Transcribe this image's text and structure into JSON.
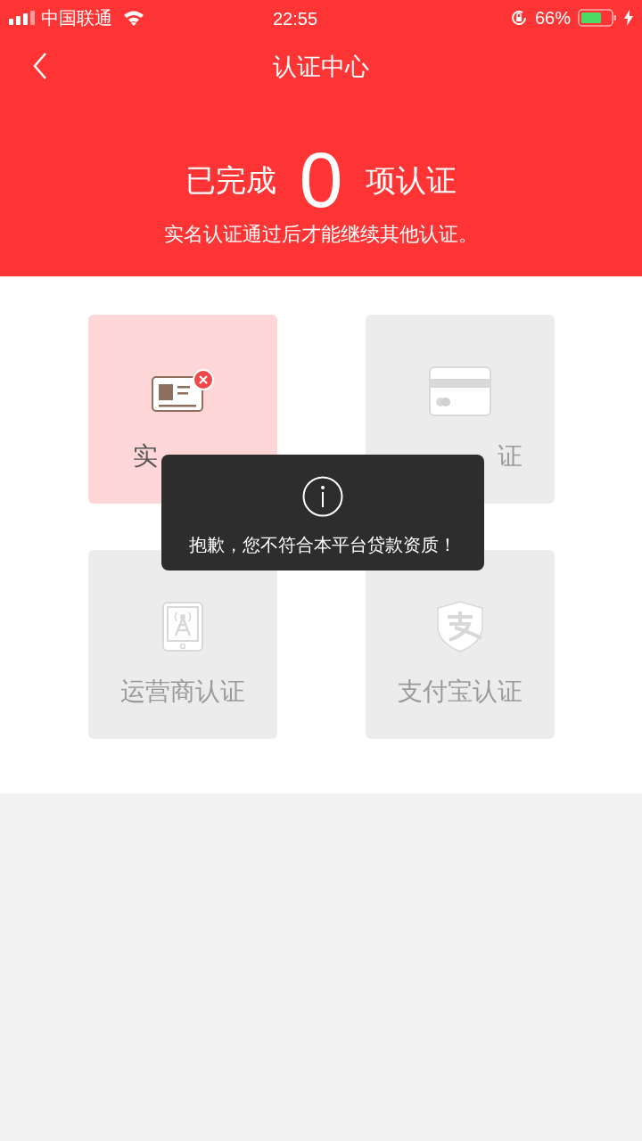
{
  "status_bar": {
    "carrier": "中国联通",
    "time": "22:55",
    "battery": "66%"
  },
  "nav": {
    "title": "认证中心"
  },
  "summary": {
    "prefix": "已完成",
    "count": "0",
    "suffix": "项认证",
    "note": "实名认证通过后才能继续其他认证。"
  },
  "cards": [
    {
      "kind": "failed",
      "label": "实",
      "cut_start": false,
      "cut_end": true
    },
    {
      "kind": "locked",
      "label": "证",
      "cut_start": true,
      "cut_end": false
    },
    {
      "kind": "locked",
      "label": "运营商认证",
      "cut_start": false,
      "cut_end": false
    },
    {
      "kind": "locked",
      "label": "支付宝认证",
      "cut_start": false,
      "cut_end": false
    }
  ],
  "toast": {
    "message": "抱歉，您不符合本平台贷款资质！"
  }
}
